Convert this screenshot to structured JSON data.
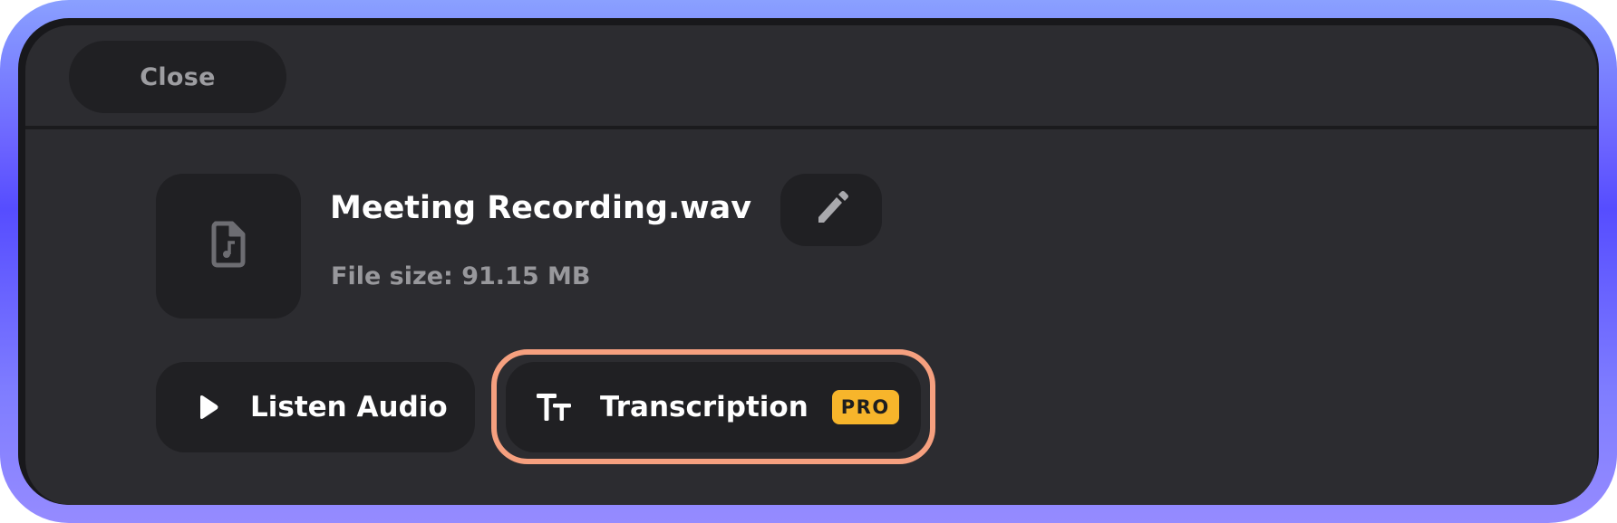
{
  "header": {
    "close_label": "Close"
  },
  "file": {
    "name": "Meeting Recording.wav",
    "size_text": "File size: 91.15 MB",
    "thumb_icon": "audio-file-icon",
    "edit_icon": "pencil-icon"
  },
  "actions": {
    "listen_label": "Listen Audio",
    "listen_icon": "play-icon",
    "transcription_label": "Transcription",
    "transcription_icon": "text-size-icon",
    "pro_badge": "PRO"
  },
  "colors": {
    "panel_bg": "#2c2c30",
    "button_bg": "#202023",
    "highlight_border": "#f6a07f",
    "pro_badge_bg": "#f7b52b",
    "frame_gradient": "#564dff"
  }
}
